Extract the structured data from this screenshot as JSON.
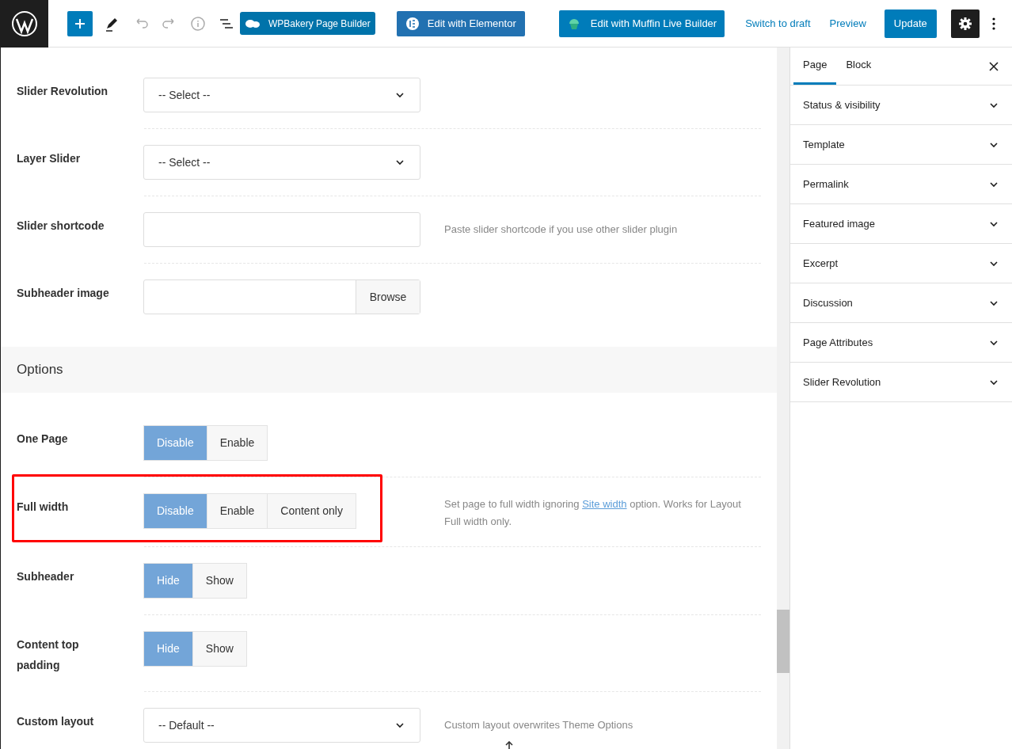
{
  "toolbar": {
    "builder_buttons": [
      "WPBakery Page Builder",
      "Edit with Elementor",
      "Edit with Muffin Live Builder"
    ],
    "links": [
      "Switch to draft",
      "Preview"
    ],
    "update": "Update",
    "settings_selected": true
  },
  "fields": [
    {
      "kind": "select",
      "label": "Slider Revolution",
      "value": "-- Select --"
    },
    {
      "kind": "select",
      "label": "Layer Slider",
      "value": "-- Select --"
    },
    {
      "kind": "input",
      "label": "Slider shortcode",
      "help": "Paste slider shortcode if you use other slider plugin"
    },
    {
      "kind": "browse",
      "label": "Subheader image",
      "button": "Browse"
    }
  ],
  "section": "Options",
  "options": [
    {
      "kind": "segmented",
      "label": "One Page",
      "highlighted": false,
      "choices": [
        {
          "label": "Disable",
          "selected": true
        },
        {
          "label": "Enable",
          "selected": false
        }
      ]
    },
    {
      "kind": "segmented",
      "label": "Full width",
      "highlighted": true,
      "choices": [
        {
          "label": "Disable",
          "selected": true
        },
        {
          "label": "Enable",
          "selected": false
        },
        {
          "label": "Content only",
          "selected": false
        }
      ],
      "help_parts": [
        "Set page to full width ignoring",
        "Site width",
        "option. Works for Layout Full width only."
      ]
    },
    {
      "kind": "segmented",
      "label": "Subheader",
      "highlighted": false,
      "choices": [
        {
          "label": "Hide",
          "selected": true
        },
        {
          "label": "Show",
          "selected": false
        }
      ]
    },
    {
      "kind": "segmented",
      "label": "Content top padding",
      "highlighted": false,
      "choices": [
        {
          "label": "Hide",
          "selected": true
        },
        {
          "label": "Show",
          "selected": false
        }
      ]
    },
    {
      "kind": "select",
      "label": "Custom layout",
      "highlighted": false,
      "value": "-- Default --",
      "help": "Custom layout overwrites Theme Options"
    }
  ],
  "sidebar": {
    "tabs": [
      {
        "label": "Page",
        "selected": true
      },
      {
        "label": "Block",
        "selected": false
      }
    ],
    "panels": [
      "Status & visibility",
      "Template",
      "Permalink",
      "Featured image",
      "Excerpt",
      "Discussion",
      "Page Attributes",
      "Slider Revolution"
    ]
  }
}
